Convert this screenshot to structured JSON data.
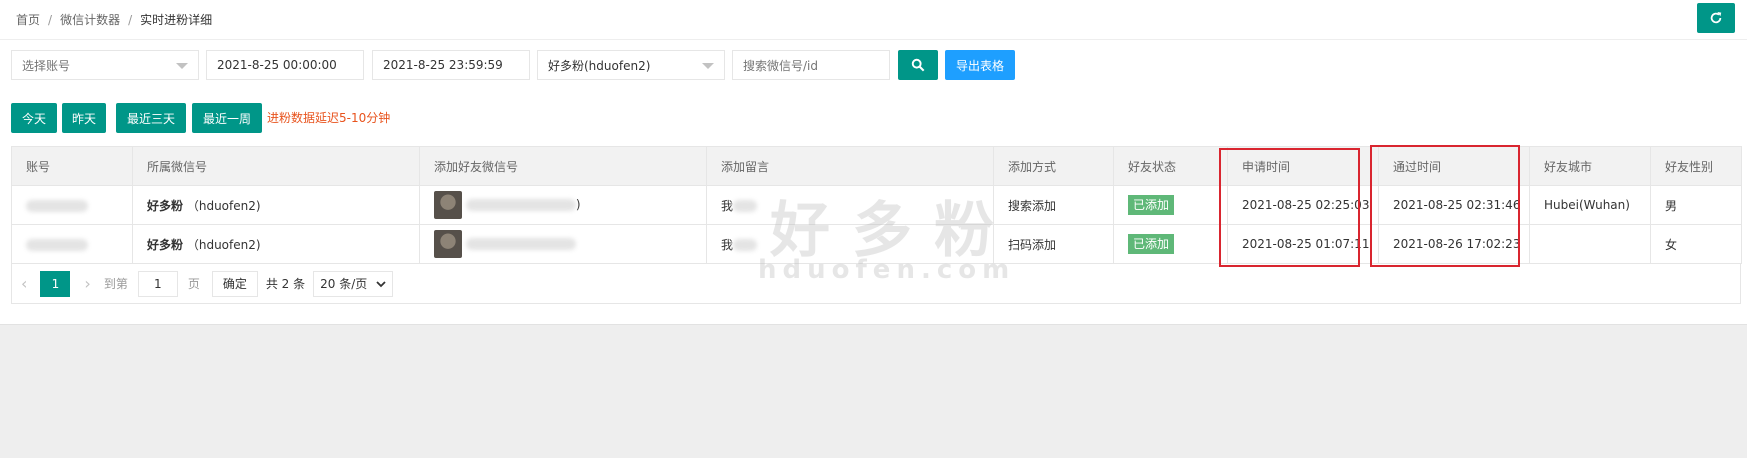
{
  "breadcrumb": [
    "首页",
    "微信计数器",
    "实时进粉详细"
  ],
  "breadcrumb_separator": "/",
  "toolbar": {
    "account_select_placeholder": "选择账号",
    "start_time": "2021-8-25 00:00:00",
    "end_time": "2021-8-25 23:59:59",
    "wechat_select_value": "好多粉(hduofen2)",
    "search_placeholder": "搜索微信号/id",
    "export_label": "导出表格"
  },
  "quick_range": [
    "今天",
    "昨天",
    "最近三天",
    "最近一周"
  ],
  "notice": "进粉数据延迟5-10分钟",
  "table": {
    "headers": [
      "账号",
      "所属微信号",
      "添加好友微信号",
      "添加留言",
      "添加方式",
      "好友状态",
      "申请时间",
      "通过时间",
      "好友城市",
      "好友性别"
    ],
    "rows": [
      {
        "owner_name": "好多粉",
        "owner_id": "（hduofen2)",
        "friend_suffix": ")",
        "message": "我",
        "method": "搜索添加",
        "status": "已添加",
        "apply_time": "2021-08-25 02:25:03",
        "pass_time": "2021-08-25 02:31:46",
        "city": "Hubei(Wuhan)",
        "gender": "男"
      },
      {
        "owner_name": "好多粉",
        "owner_id": "（hduofen2)",
        "friend_suffix": "",
        "message": "我",
        "method": "扫码添加",
        "status": "已添加",
        "apply_time": "2021-08-25 01:07:11",
        "pass_time": "2021-08-26 17:02:23",
        "city": "",
        "gender": "女"
      }
    ]
  },
  "pagination": {
    "current_page": "1",
    "goto_label": "到第",
    "page_input": "1",
    "page_unit": "页",
    "confirm_label": "确定",
    "total": "共 2 条",
    "page_size": "20 条/页"
  },
  "watermark": {
    "brand": "好多粉",
    "domain": "hduofen.com"
  },
  "colors": {
    "primary": "#009688",
    "export": "#1e9fff",
    "notice": "#e8531d",
    "status_tag": "#5fb878",
    "highlight_box": "#d9252f"
  },
  "icons": {
    "refresh": "refresh-icon",
    "search": "search-icon",
    "dropdown": "caret-down-icon",
    "prev": "chevron-left-icon",
    "next": "chevron-right-icon"
  }
}
